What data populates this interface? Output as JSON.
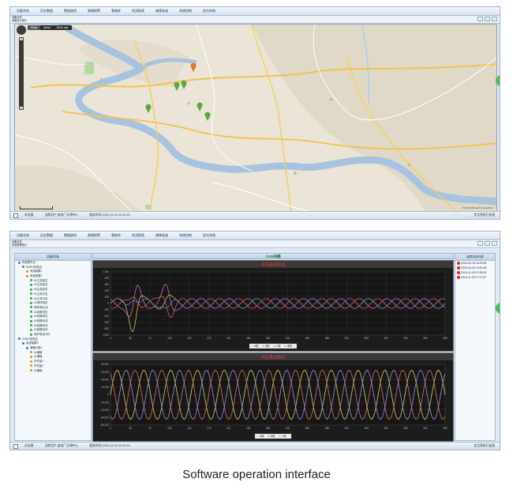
{
  "menu": [
    "设备状态",
    "历史数据",
    "数据曲线",
    "故障报警",
    "事故库",
    "检测报表",
    "故障录波",
    "系统控制",
    "定向系统"
  ],
  "window1": {
    "tabs": [
      "设备状态",
      "地图显示窗口"
    ],
    "win_controls": [
      "_",
      "□",
      "×"
    ],
    "map": {
      "types": [
        "Road",
        "Aerial",
        "Bird's eye"
      ],
      "credit": "© 2016 Microsoft Corporation"
    },
    "status": {
      "seg1": "未连接",
      "seg2": "当前用户:省电厂分调中心",
      "seg3": "服务时间:2016-12-04 13:20:40",
      "right": "定位系统已连接"
    }
  },
  "window2": {
    "tabs": [
      "设备状态",
      "录波数据窗口"
    ],
    "win_controls": [
      "_",
      "□",
      "×"
    ],
    "left_panel_title": "设备列表",
    "tree": [
      {
        "label": "系统根节点",
        "level": 0,
        "color": "#2b7bd6"
      },
      {
        "label": "500kV变电站",
        "level": 1,
        "color": "#2b7bd6"
      },
      {
        "label": "录波装置1",
        "level": 2,
        "color": "#e48a1c"
      },
      {
        "label": "录波装置2",
        "level": 2,
        "color": "#e48a1c"
      },
      {
        "label": "#1主变高压",
        "level": 3,
        "color": "#3ca33c"
      },
      {
        "label": "#2主变高压",
        "level": 3,
        "color": "#3ca33c"
      },
      {
        "label": "#3主变高压",
        "level": 3,
        "color": "#3ca33c"
      },
      {
        "label": "#1主变中压",
        "level": 3,
        "color": "#3ca33c"
      },
      {
        "label": "#2主变中压",
        "level": 3,
        "color": "#3ca33c"
      },
      {
        "label": "#1母线电压",
        "level": 3,
        "color": "#3ca33c"
      },
      {
        "label": "母线电压(A)",
        "level": 3,
        "color": "#3ca33c"
      },
      {
        "label": "#1线路电压",
        "level": 3,
        "color": "#3ca33c"
      },
      {
        "label": "#2线路电压",
        "level": 3,
        "color": "#3ca33c"
      },
      {
        "label": "#1线路电流",
        "level": 3,
        "color": "#3ca33c"
      },
      {
        "label": "#2线路电流",
        "level": 3,
        "color": "#3ca33c"
      },
      {
        "label": "#3线路电流",
        "level": 3,
        "color": "#3ca33c"
      },
      {
        "label": "零序电流(3I0)",
        "level": 3,
        "color": "#3ca33c"
      },
      {
        "label": "220kV变电站",
        "level": 0,
        "color": "#2b7bd6"
      },
      {
        "label": "录波装置3",
        "level": 1,
        "color": "#2b7bd6"
      },
      {
        "label": "通道分组1",
        "level": 2,
        "color": "#2b7bd6"
      },
      {
        "label": "#1通道",
        "level": 3,
        "color": "#e48a1c"
      },
      {
        "label": "#2通道",
        "level": 3,
        "color": "#e48a1c"
      },
      {
        "label": "开关量1",
        "level": 3,
        "color": "#e48a1c"
      },
      {
        "label": "开关量2",
        "level": 3,
        "color": "#e48a1c"
      },
      {
        "label": "#3通道",
        "level": 3,
        "color": "#e48a1c"
      }
    ],
    "center_title": "#125间隔",
    "alarm_list": [
      "2016-09-15 16:40:54",
      "2016-10-04 14:54:48",
      "2016-11-18 17:08:09",
      "2016-11-20 17:17:57"
    ],
    "status": {
      "seg1": "未连接",
      "seg2": "当前用户:省电厂分调中心",
      "seg3": "服务时间:2016-12-04 13:20:40",
      "right": "定位系统已连接"
    }
  },
  "charts": [
    {
      "title": "电流录波曲线",
      "y_ticks": [
        "1.00k",
        "800",
        "600",
        "400",
        "200",
        "0",
        "-200",
        "-400",
        "-600",
        "-800",
        "-1000"
      ],
      "x_ticks": [
        "0",
        "35",
        "70",
        "105",
        "140",
        "175",
        "210",
        "245",
        "280",
        "315",
        "350",
        "385",
        "420",
        "455",
        "490",
        "525",
        "560",
        "595"
      ],
      "legend": [
        "A相",
        "B相",
        "C相",
        "零序"
      ],
      "series_colors": [
        "#c8c15a",
        "#d36aa8",
        "#d06060",
        "#6a7ad0"
      ]
    },
    {
      "title": "电压录波曲线",
      "y_ticks": [
        "80,000",
        "60,000",
        "40,000",
        "20,000",
        "0",
        "-20,000",
        "-40,000",
        "-60,000",
        "-80,000"
      ],
      "x_ticks": [
        "0",
        "35",
        "70",
        "105",
        "140",
        "175",
        "210",
        "245",
        "280",
        "315",
        "350",
        "385",
        "420",
        "455",
        "490",
        "525",
        "560",
        "595"
      ],
      "legend": [
        "A相",
        "B相",
        "C相"
      ],
      "series_colors": [
        "#d8d064",
        "#e06a6a",
        "#9a8edb"
      ]
    }
  ],
  "caption": "Software operation interface",
  "colors": {
    "accent": "#0b7d31",
    "alarm": "#d3322b",
    "map_river": "#a8c3e0"
  }
}
